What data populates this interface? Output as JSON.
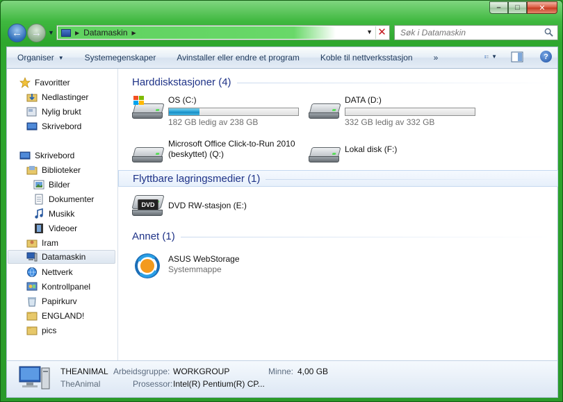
{
  "window": {
    "controls": {
      "minimize": "–",
      "maximize": "□",
      "close": "✕"
    }
  },
  "nav": {
    "back_symbol": "←",
    "forward_symbol": "→",
    "address_segment": "Datamaskin",
    "search_placeholder": "Søk i Datamaskin"
  },
  "toolbar": {
    "items": [
      "Organiser",
      "Systemegenskaper",
      "Avinstaller eller endre et program",
      "Koble til nettverksstasjon"
    ],
    "more": "»",
    "help": "?"
  },
  "sidebar": {
    "favorites_header": "Favoritter",
    "favorites": [
      "Nedlastinger",
      "Nylig brukt",
      "Skrivebord"
    ],
    "desktop": "Skrivebord",
    "libraries": "Biblioteker",
    "library_items": [
      "Bilder",
      "Dokumenter",
      "Musikk",
      "Videoer"
    ],
    "others": [
      "Iram",
      "Datamaskin",
      "Nettverk",
      "Kontrollpanel",
      "Papirkurv",
      "ENGLAND!",
      "pics"
    ]
  },
  "groups": {
    "hdd": {
      "title": "Harddiskstasjoner (4)",
      "drives": [
        {
          "name": "OS (C:)",
          "free": "182 GB ledig av 238 GB",
          "used_fraction": 0.235
        },
        {
          "name": "DATA (D:)",
          "free": "332 GB ledig av 332 GB",
          "used_fraction": 0.0
        },
        {
          "name": "Microsoft Office Click-to-Run 2010",
          "name2": "(beskyttet) (Q:)"
        },
        {
          "name": "Lokal disk (F:)"
        }
      ]
    },
    "removable": {
      "title": "Flyttbare lagringsmedier (1)",
      "drive": "DVD RW-stasjon (E:)",
      "badge": "DVD"
    },
    "other": {
      "title": "Annet (1)",
      "item": "ASUS WebStorage",
      "sub": "Systemmappe"
    }
  },
  "status": {
    "computer_name": "THEANIMAL",
    "computer_sub": "TheAnimal",
    "workgroup_label": "Arbeidsgruppe:",
    "workgroup_value": "WORKGROUP",
    "memory_label": "Minne:",
    "memory_value": "4,00 GB",
    "processor_label": "Prosessor:",
    "processor_value": "Intel(R) Pentium(R) CP..."
  },
  "colors": {
    "frame": "#2a9a2a",
    "address_fill": "#5fd15f",
    "group_title": "#1e3287",
    "bar_fill": "#27a2d8"
  }
}
